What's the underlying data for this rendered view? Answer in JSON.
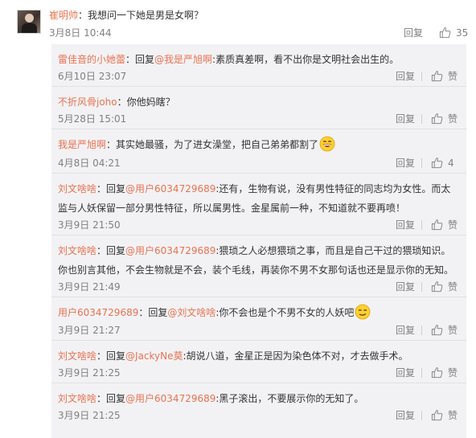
{
  "top_comment": {
    "username": "崔明帅",
    "text": "：我想问一下她是男是女啊？",
    "time": "3月8日 10:44",
    "reply_label": "回复",
    "like_count": "35"
  },
  "replies": [
    {
      "user": "雷佳音的小她蕾",
      "prefix": "：回复",
      "at": "@我是严旭啊",
      "body": ":素质真差啊，看不出你是文明社会出生的。",
      "emoji": "",
      "time": "6月10日 23:07",
      "reply_label": "回复",
      "like": "赞"
    },
    {
      "user": "不折风骨joho",
      "prefix": "：你他妈瞎？",
      "at": "",
      "body": "",
      "emoji": "",
      "time": "5月28日 15:01",
      "reply_label": "回复",
      "like": "赞"
    },
    {
      "user": "我是严旭啊",
      "prefix": "：其实她最骚，为了进女澡堂，把自己弟弟都割了",
      "at": "",
      "body": "",
      "emoji": "grin-emoji",
      "time": "4月8日 04:21",
      "reply_label": "回复",
      "like": "4"
    },
    {
      "user": "刘文啥啥",
      "prefix": "：回复",
      "at": "@用户6034729689",
      "body": ":还有，生物有说，没有男性特征的同志均为女性。而太监与人妖保留一部分男性特征，所以属男性。金星属前一种，不知道就不要再喷！",
      "emoji": "",
      "time": "3月9日 21:50",
      "reply_label": "回复",
      "like": "赞"
    },
    {
      "user": "刘文啥啥",
      "prefix": "：回复",
      "at": "@用户6034729689",
      "body": ":猥琐之人必想猥琐之事，而且是自己干过的猥琐知识。你也别言其他，不会生物就是不会，装个毛线，再装你不男不女那句话也还是显示你的无知。",
      "emoji": "",
      "time": "3月9日 21:49",
      "reply_label": "回复",
      "like": "赞"
    },
    {
      "user": "用户6034729689",
      "prefix": "：回复",
      "at": "@刘文啥啥",
      "body": ":你不会也是个不男不女的人妖吧",
      "emoji": "smirk-emoji",
      "time": "3月9日 21:27",
      "reply_label": "回复",
      "like": "赞"
    },
    {
      "user": "刘文啥啥",
      "prefix": "：回复",
      "at": "@JackyNe莫",
      "body": ":胡说八道，金星正是因为染色体不对，才去做手术。",
      "emoji": "",
      "time": "3月9日 21:25",
      "reply_label": "回复",
      "like": "赞"
    },
    {
      "user": "刘文啥啥",
      "prefix": "：回复",
      "at": "@用户6034729689",
      "body": ":黑子滚出，不要展示你的无知了。",
      "emoji": "",
      "time": "3月9日 21:25",
      "reply_label": "回复",
      "like": "赞"
    }
  ],
  "colors": {
    "link": "#eb7350",
    "panel_bg": "#f2f2f5",
    "text": "#333333",
    "muted": "#808080"
  }
}
